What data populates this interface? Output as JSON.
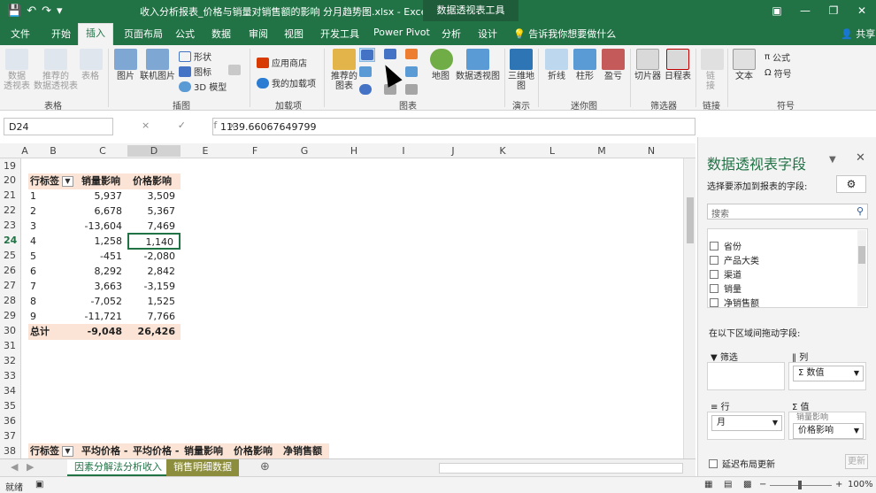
{
  "titlebar": {
    "document_title": "收入分析报表_价格与销量对销售额的影响 分月趋势图.xlsx - Excel",
    "context_tab": "数据透视表工具",
    "icons": [
      "save-icon",
      "undo-icon",
      "redo-icon",
      "customize-icon"
    ]
  },
  "tabs": [
    "文件",
    "开始",
    "插入",
    "页面布局",
    "公式",
    "数据",
    "审阅",
    "视图",
    "开发工具",
    "Power Pivot",
    "分析",
    "设计"
  ],
  "tell_me": "告诉我你想要做什么",
  "share": "共享",
  "ribbon": {
    "pivot_table": "数据\n透视表",
    "recommended_pivot": "推荐的\n数据透视表",
    "table": "表格",
    "pictures": "图片",
    "online_pictures": "联机图片",
    "shapes": "形状",
    "icons": "图标",
    "model3d": "3D 模型",
    "store": "应用商店",
    "my_addins": "我的加载项",
    "recommended_charts": "推荐的\n图表",
    "maps": "地图",
    "pivot_chart": "数据透视图",
    "map3d": "三维地\n图",
    "line": "折线",
    "column": "柱形",
    "winloss": "盈亏",
    "slicer": "切片器",
    "timeline": "日程表",
    "link": "链\n接",
    "text": "文本",
    "equation": "公式",
    "symbol": "符号",
    "groups": [
      "表格",
      "插图",
      "加载项",
      "图表",
      "演示",
      "迷你图",
      "筛选器",
      "链接",
      "符号"
    ]
  },
  "formula_bar": {
    "name_box": "D24",
    "value": "1139.66067649799",
    "fx_symbols": "× ✓ fx"
  },
  "columns": [
    "A",
    "B",
    "C",
    "D",
    "E",
    "F",
    "G",
    "H",
    "I",
    "J",
    "K",
    "L",
    "M",
    "N"
  ],
  "rows": [
    "19",
    "20",
    "21",
    "22",
    "23",
    "24",
    "25",
    "26",
    "27",
    "28",
    "29",
    "30",
    "31",
    "32",
    "33",
    "34",
    "35",
    "36",
    "37",
    "38"
  ],
  "pivot": {
    "headers": [
      "行标签",
      "销量影响",
      "价格影响"
    ],
    "data": [
      [
        "1",
        "5,937",
        "3,509"
      ],
      [
        "2",
        "6,678",
        "5,367"
      ],
      [
        "3",
        "-13,604",
        "7,469"
      ],
      [
        "4",
        "1,258",
        "1,140"
      ],
      [
        "5",
        "-451",
        "-2,080"
      ],
      [
        "6",
        "8,292",
        "2,842"
      ],
      [
        "7",
        "3,663",
        "-3,159"
      ],
      [
        "8",
        "-7,052",
        "1,525"
      ],
      [
        "9",
        "-11,721",
        "7,766"
      ]
    ],
    "total": [
      "总计",
      "-9,048",
      "26,426"
    ]
  },
  "pivot2_headers": [
    "行标签",
    "平均价格 -",
    "平均价格 -",
    "销量影响",
    "价格影响",
    "净销售额"
  ],
  "sheet_tabs": [
    "因素分解法分析收入",
    "销售明细数据"
  ],
  "status": {
    "ready": "就绪",
    "zoom": "100%"
  },
  "field_panel": {
    "title": "数据透视表字段",
    "subtitle": "选择要添加到报表的字段:",
    "search_placeholder": "搜索",
    "fields": [
      "省份",
      "产品大类",
      "渠道",
      "销量",
      "净销售额"
    ],
    "drag_label": "在以下区域间拖动字段:",
    "filter_label": "筛选",
    "columns_label": "列",
    "rows_label": "行",
    "values_label": "值",
    "columns_pill": "Σ 数值",
    "rows_pill": "月",
    "values_pill": "价格影响",
    "values_pill_partial": "销量影响",
    "defer_label": "延迟布局更新",
    "update_button": "更新"
  },
  "colors": {
    "excel_green": "#217346",
    "pivot_header": "#fbe4d5"
  }
}
